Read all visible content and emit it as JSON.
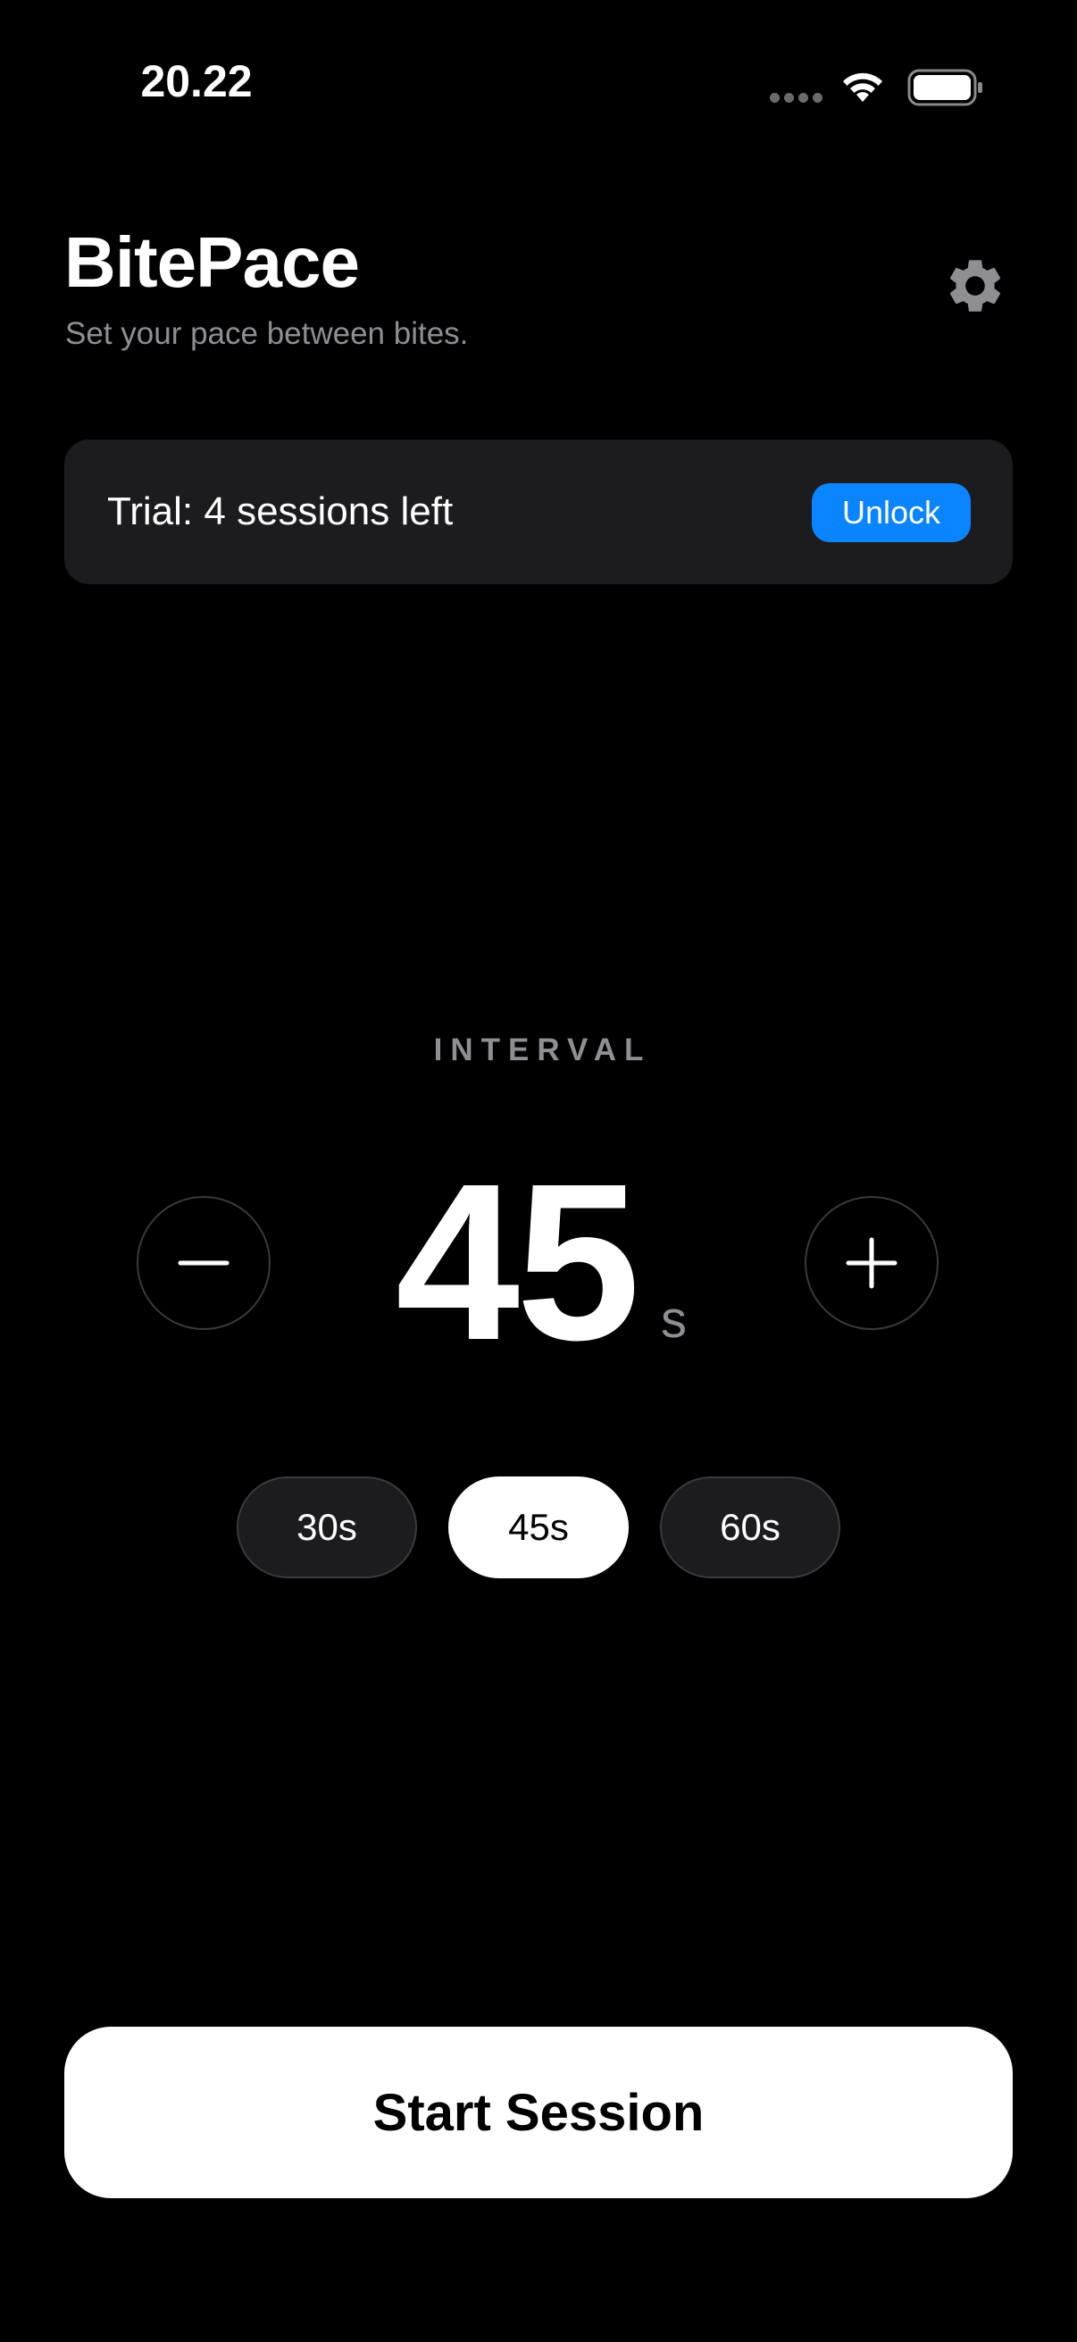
{
  "status_bar": {
    "time": "20.22"
  },
  "header": {
    "title": "BitePace",
    "subtitle": "Set your pace between bites.",
    "settings_icon": "gear-icon"
  },
  "trial": {
    "text": "Trial: 4 sessions left",
    "unlock_label": "Unlock"
  },
  "interval": {
    "label": "INTERVAL",
    "value": "45",
    "unit": "s",
    "minus_icon": "minus-icon",
    "plus_icon": "plus-icon"
  },
  "presets": [
    {
      "label": "30s",
      "selected": false
    },
    {
      "label": "45s",
      "selected": true
    },
    {
      "label": "60s",
      "selected": false
    }
  ],
  "start_button": {
    "label": "Start Session"
  },
  "colors": {
    "background": "#000000",
    "card": "#1c1c1e",
    "accent": "#0a84ff",
    "secondary_text": "#8e8e93"
  }
}
